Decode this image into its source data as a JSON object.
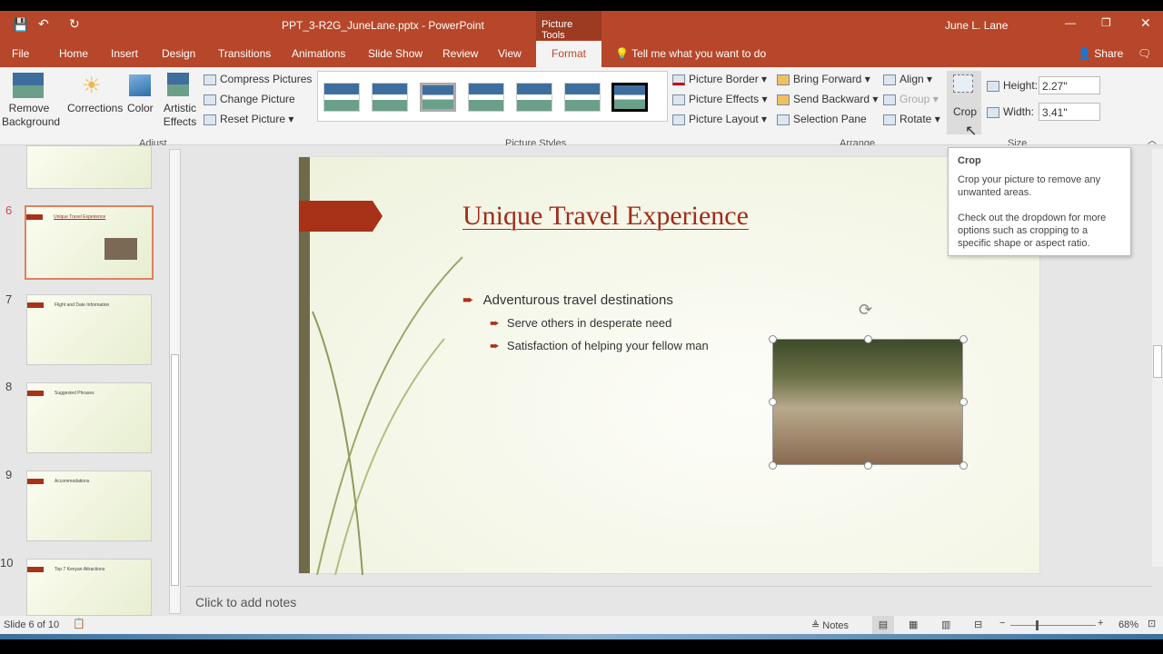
{
  "titlebar": {
    "filename": "PPT_3-R2G_JuneLane.pptx - PowerPoint",
    "context_tab": "Picture Tools",
    "user": "June L. Lane"
  },
  "tabs": [
    "File",
    "Home",
    "Insert",
    "Design",
    "Transitions",
    "Animations",
    "Slide Show",
    "Review",
    "View",
    "Format"
  ],
  "active_tab": "Format",
  "tell_me": "Tell me what you want to do",
  "share": "Share",
  "ribbon": {
    "adjust": {
      "label": "Adjust",
      "remove_background": "Remove Background",
      "corrections": "Corrections",
      "color": "Color",
      "artistic_effects": "Artistic Effects",
      "compress": "Compress Pictures",
      "change": "Change Picture",
      "reset": "Reset Picture"
    },
    "picture_styles": {
      "label": "Picture Styles",
      "picture_border": "Picture Border",
      "picture_effects": "Picture Effects",
      "picture_layout": "Picture Layout"
    },
    "arrange": {
      "label": "Arrange",
      "bring_forward": "Bring Forward",
      "send_backward": "Send Backward",
      "selection_pane": "Selection Pane",
      "align": "Align",
      "group": "Group",
      "rotate": "Rotate"
    },
    "size": {
      "label": "Size",
      "crop": "Crop",
      "height_label": "Height:",
      "height": "2.27\"",
      "width_label": "Width:",
      "width": "3.41\""
    }
  },
  "tooltip": {
    "title": "Crop",
    "line1": "Crop your picture to remove any unwanted areas.",
    "line2": "Check out the dropdown for more options such as cropping to a specific shape or aspect ratio."
  },
  "thumbnails": [
    {
      "num": "6",
      "title": "Unique Travel Experience"
    },
    {
      "num": "7",
      "title": "Flight and Date Information"
    },
    {
      "num": "8",
      "title": "Suggested Phrases"
    },
    {
      "num": "9",
      "title": "Accommodations"
    },
    {
      "num": "10",
      "title": "Top 7 Kenyan Attractions"
    }
  ],
  "slide": {
    "title": "Unique Travel Experience",
    "bullet1": "Adventurous travel destinations",
    "sub1": "Serve others in desperate need",
    "sub2": "Satisfaction of helping your fellow man"
  },
  "notes_placeholder": "Click to add notes",
  "status": {
    "slide": "Slide 6 of 10",
    "notes": "Notes",
    "zoom": "68%"
  },
  "colors": {
    "accent": "#b7472a",
    "title": "#a32b1a"
  }
}
